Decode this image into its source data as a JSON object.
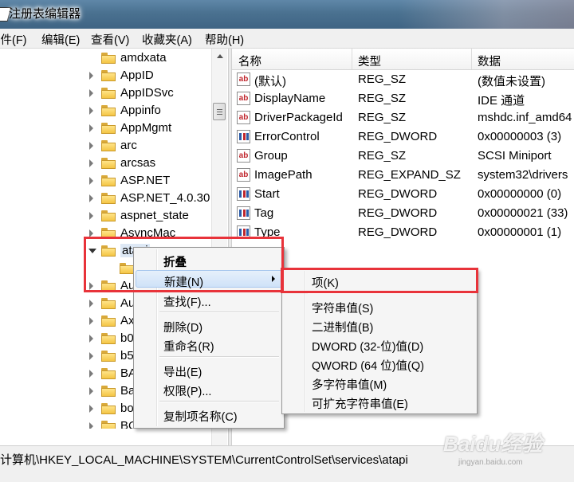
{
  "window": {
    "title": "注册表编辑器"
  },
  "menubar": [
    "文件(F)",
    "编辑(E)",
    "查看(V)",
    "收藏夹(A)",
    "帮助(H)"
  ],
  "tree": {
    "items": [
      {
        "label": "amdxata"
      },
      {
        "label": "AppID"
      },
      {
        "label": "AppIDSvc"
      },
      {
        "label": "Appinfo"
      },
      {
        "label": "AppMgmt"
      },
      {
        "label": "arc"
      },
      {
        "label": "arcsas"
      },
      {
        "label": "ASP.NET"
      },
      {
        "label": "ASP.NET_4.0.30"
      },
      {
        "label": "aspnet_state"
      },
      {
        "label": "AsyncMac"
      },
      {
        "label": "atapi"
      },
      {
        "label": ""
      },
      {
        "label": "Au"
      },
      {
        "label": "Au"
      },
      {
        "label": "Ax"
      },
      {
        "label": "b0"
      },
      {
        "label": "b5"
      },
      {
        "label": "BA"
      },
      {
        "label": "Ba"
      },
      {
        "label": "bo"
      },
      {
        "label": "BC"
      }
    ]
  },
  "list": {
    "headers": {
      "name": "名称",
      "type": "类型",
      "data": "数据"
    },
    "rows": [
      {
        "icon": "string-value-icon",
        "name": "(默认)",
        "type": "REG_SZ",
        "data": "(数值未设置)"
      },
      {
        "icon": "string-value-icon",
        "name": "DisplayName",
        "type": "REG_SZ",
        "data": "IDE 通道"
      },
      {
        "icon": "string-value-icon",
        "name": "DriverPackageId",
        "type": "REG_SZ",
        "data": "mshdc.inf_amd64"
      },
      {
        "icon": "binary-value-icon",
        "name": "ErrorControl",
        "type": "REG_DWORD",
        "data": "0x00000003 (3)"
      },
      {
        "icon": "string-value-icon",
        "name": "Group",
        "type": "REG_SZ",
        "data": "SCSI Miniport"
      },
      {
        "icon": "string-value-icon",
        "name": "ImagePath",
        "type": "REG_EXPAND_SZ",
        "data": "system32\\drivers"
      },
      {
        "icon": "binary-value-icon",
        "name": "Start",
        "type": "REG_DWORD",
        "data": "0x00000000 (0)"
      },
      {
        "icon": "binary-value-icon",
        "name": "Tag",
        "type": "REG_DWORD",
        "data": "0x00000021 (33)"
      },
      {
        "icon": "binary-value-icon",
        "name": "Type",
        "type": "REG_DWORD",
        "data": "0x00000001 (1)"
      }
    ]
  },
  "context_menu": {
    "items": [
      "折叠",
      "新建(N)",
      "查找(F)...",
      "删除(D)",
      "重命名(R)",
      "导出(E)",
      "权限(P)...",
      "复制项名称(C)"
    ]
  },
  "submenu": {
    "items": [
      "项(K)",
      "字符串值(S)",
      "二进制值(B)",
      "DWORD (32-位)值(D)",
      "QWORD (64 位)值(Q)",
      "多字符串值(M)",
      "可扩充字符串值(E)"
    ]
  },
  "statusbar": {
    "path": "计算机\\HKEY_LOCAL_MACHINE\\SYSTEM\\CurrentControlSet\\services\\atapi"
  },
  "watermark": {
    "logo": "Baidu经验",
    "url": "jingyan.baidu.com"
  },
  "colors": {
    "highlight_box": "#e8333a",
    "title_bar": "#4a7190",
    "menu_hover": "#cfe2f8"
  }
}
